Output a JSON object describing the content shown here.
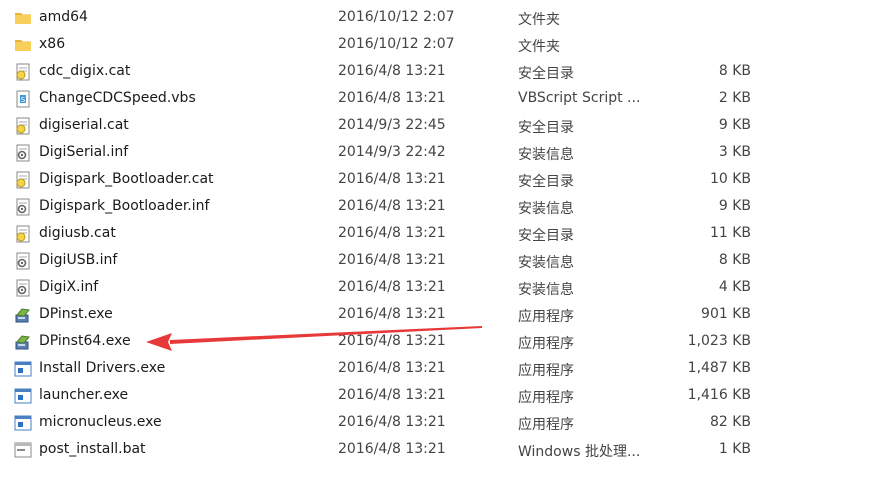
{
  "files": [
    {
      "icon": "folder-icon",
      "name": "amd64",
      "date": "2016/10/12 2:07",
      "type": "文件夹",
      "size": ""
    },
    {
      "icon": "folder-icon",
      "name": "x86",
      "date": "2016/10/12 2:07",
      "type": "文件夹",
      "size": ""
    },
    {
      "icon": "security-catalog-icon",
      "name": "cdc_digix.cat",
      "date": "2016/4/8 13:21",
      "type": "安全目录",
      "size": "8 KB"
    },
    {
      "icon": "vbscript-icon",
      "name": "ChangeCDCSpeed.vbs",
      "date": "2016/4/8 13:21",
      "type": "VBScript Script ...",
      "size": "2 KB"
    },
    {
      "icon": "security-catalog-icon",
      "name": "digiserial.cat",
      "date": "2014/9/3 22:45",
      "type": "安全目录",
      "size": "9 KB"
    },
    {
      "icon": "setup-info-icon",
      "name": "DigiSerial.inf",
      "date": "2014/9/3 22:42",
      "type": "安装信息",
      "size": "3 KB"
    },
    {
      "icon": "security-catalog-icon",
      "name": "Digispark_Bootloader.cat",
      "date": "2016/4/8 13:21",
      "type": "安全目录",
      "size": "10 KB"
    },
    {
      "icon": "setup-info-icon",
      "name": "Digispark_Bootloader.inf",
      "date": "2016/4/8 13:21",
      "type": "安装信息",
      "size": "9 KB"
    },
    {
      "icon": "security-catalog-icon",
      "name": "digiusb.cat",
      "date": "2016/4/8 13:21",
      "type": "安全目录",
      "size": "11 KB"
    },
    {
      "icon": "setup-info-icon",
      "name": "DigiUSB.inf",
      "date": "2016/4/8 13:21",
      "type": "安装信息",
      "size": "8 KB"
    },
    {
      "icon": "setup-info-icon",
      "name": "DigiX.inf",
      "date": "2016/4/8 13:21",
      "type": "安装信息",
      "size": "4 KB"
    },
    {
      "icon": "installer-exe-icon",
      "name": "DPinst.exe",
      "date": "2016/4/8 13:21",
      "type": "应用程序",
      "size": "901 KB"
    },
    {
      "icon": "installer-exe-icon",
      "name": "DPinst64.exe",
      "date": "2016/4/8 13:21",
      "type": "应用程序",
      "size": "1,023 KB"
    },
    {
      "icon": "application-exe-icon",
      "name": "Install Drivers.exe",
      "date": "2016/4/8 13:21",
      "type": "应用程序",
      "size": "1,487 KB"
    },
    {
      "icon": "application-exe-icon",
      "name": "launcher.exe",
      "date": "2016/4/8 13:21",
      "type": "应用程序",
      "size": "1,416 KB"
    },
    {
      "icon": "application-exe-icon",
      "name": "micronucleus.exe",
      "date": "2016/4/8 13:21",
      "type": "应用程序",
      "size": "82 KB"
    },
    {
      "icon": "batch-file-icon",
      "name": "post_install.bat",
      "date": "2016/4/8 13:21",
      "type": "Windows 批处理...",
      "size": "1 KB"
    }
  ],
  "annotation": {
    "arrow_color": "#e8393a"
  }
}
